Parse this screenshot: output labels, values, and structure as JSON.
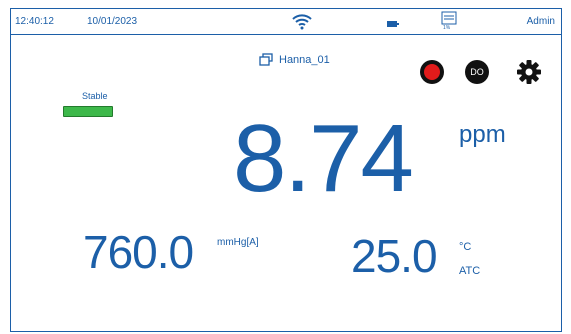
{
  "status_bar": {
    "time": "12:40:12",
    "date": "10/01/2023",
    "wifi_icon": "wifi-icon",
    "battery_icon": "battery-icon",
    "log_icon": "log-memory-icon",
    "log_percent": "1%",
    "user": "Admin"
  },
  "probe": {
    "icon": "probe-copy-icon",
    "name": "Hanna_01"
  },
  "buttons": {
    "record_icon": "record-icon",
    "do_label": "DO",
    "settings_icon": "gear-icon"
  },
  "stability": {
    "label": "Stable",
    "color": "#3db84a"
  },
  "reading": {
    "value": "8.74",
    "unit": "ppm"
  },
  "pressure": {
    "value": "760.0",
    "unit": "mmHg[A]"
  },
  "temperature": {
    "value": "25.0",
    "unit": "°C",
    "compensation": "ATC"
  },
  "colors": {
    "accent": "#1c5fa8",
    "record": "#e21b1b"
  }
}
